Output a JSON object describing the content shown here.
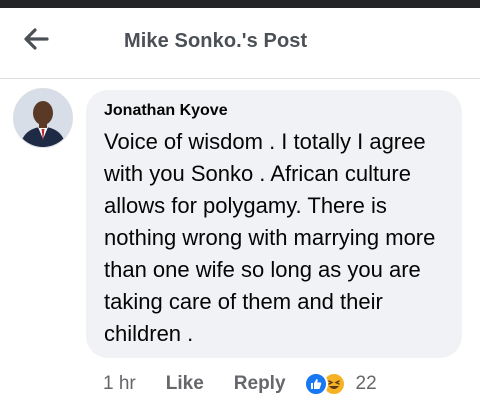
{
  "header": {
    "back_icon": "arrow-left-icon",
    "title": "Mike Sonko.'s Post"
  },
  "comment": {
    "author": "Jonathan Kyove",
    "text": "Voice of wisdom . I totally I agree with you Sonko . African culture allows for polygamy. There is nothing wrong with marrying more than one wife so long as you are taking care of them and their children .",
    "time": "1 hr",
    "like_label": "Like",
    "reply_label": "Reply",
    "reactions": [
      "like-reaction-icon",
      "haha-reaction-icon"
    ],
    "reaction_count": "22"
  },
  "colors": {
    "bubble": "#f0f2f5",
    "text": "#050505",
    "meta": "#65676b",
    "title": "#4b4f56",
    "like_blue": "#1877f2",
    "haha_yellow": "#f7b125"
  }
}
